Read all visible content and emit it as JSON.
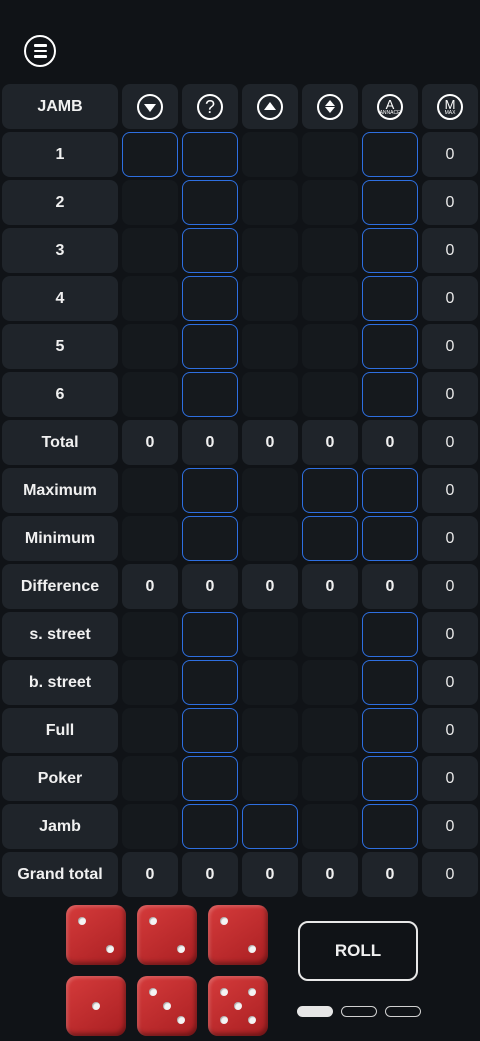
{
  "header": {
    "title": "JAMB",
    "menu_icon": "menu-icon"
  },
  "columns": [
    {
      "icon": "arrow-down-icon"
    },
    {
      "icon": "question-icon",
      "glyph": "?"
    },
    {
      "icon": "arrow-up-icon"
    },
    {
      "icon": "arrow-up-down-icon"
    },
    {
      "icon": "announce-icon",
      "glyph": "A",
      "sub": "ANNACE"
    },
    {
      "icon": "max-icon",
      "glyph": "M",
      "sub": "MAX"
    }
  ],
  "rows": [
    {
      "label": "1",
      "cells": [
        "active",
        "active",
        "empty",
        "empty",
        "active"
      ],
      "sum": "0"
    },
    {
      "label": "2",
      "cells": [
        "empty",
        "active",
        "empty",
        "empty",
        "active"
      ],
      "sum": "0"
    },
    {
      "label": "3",
      "cells": [
        "empty",
        "active",
        "empty",
        "empty",
        "active"
      ],
      "sum": "0"
    },
    {
      "label": "4",
      "cells": [
        "empty",
        "active",
        "empty",
        "empty",
        "active"
      ],
      "sum": "0"
    },
    {
      "label": "5",
      "cells": [
        "empty",
        "active",
        "empty",
        "empty",
        "active"
      ],
      "sum": "0"
    },
    {
      "label": "6",
      "cells": [
        "empty",
        "active",
        "empty",
        "empty",
        "active"
      ],
      "sum": "0"
    },
    {
      "label": "Total",
      "values": [
        "0",
        "0",
        "0",
        "0",
        "0"
      ],
      "sum": "0"
    },
    {
      "label": "Maximum",
      "cells": [
        "empty",
        "active",
        "empty",
        "active",
        "active"
      ],
      "sum": "0"
    },
    {
      "label": "Minimum",
      "cells": [
        "empty",
        "active",
        "empty",
        "active",
        "active"
      ],
      "sum": "0"
    },
    {
      "label": "Difference",
      "values": [
        "0",
        "0",
        "0",
        "0",
        "0"
      ],
      "sum": "0"
    },
    {
      "label": "s. street",
      "cells": [
        "empty",
        "active",
        "empty",
        "empty",
        "active"
      ],
      "sum": "0"
    },
    {
      "label": "b. street",
      "cells": [
        "empty",
        "active",
        "empty",
        "empty",
        "active"
      ],
      "sum": "0"
    },
    {
      "label": "Full",
      "cells": [
        "empty",
        "active",
        "empty",
        "empty",
        "active"
      ],
      "sum": "0"
    },
    {
      "label": "Poker",
      "cells": [
        "empty",
        "active",
        "empty",
        "empty",
        "active"
      ],
      "sum": "0"
    },
    {
      "label": "Jamb",
      "cells": [
        "empty",
        "active",
        "active",
        "empty",
        "active"
      ],
      "sum": "0"
    },
    {
      "label": "Grand total",
      "values": [
        "0",
        "0",
        "0",
        "0",
        "0"
      ],
      "sum": "0"
    }
  ],
  "dice": [
    2,
    2,
    2,
    1,
    3,
    5
  ],
  "roll_button": {
    "label": "ROLL"
  },
  "pager": {
    "pages": 3,
    "active": 0
  },
  "colors": {
    "accent": "#2e6fe0",
    "die": "#c62a2d",
    "background": "#101317"
  }
}
